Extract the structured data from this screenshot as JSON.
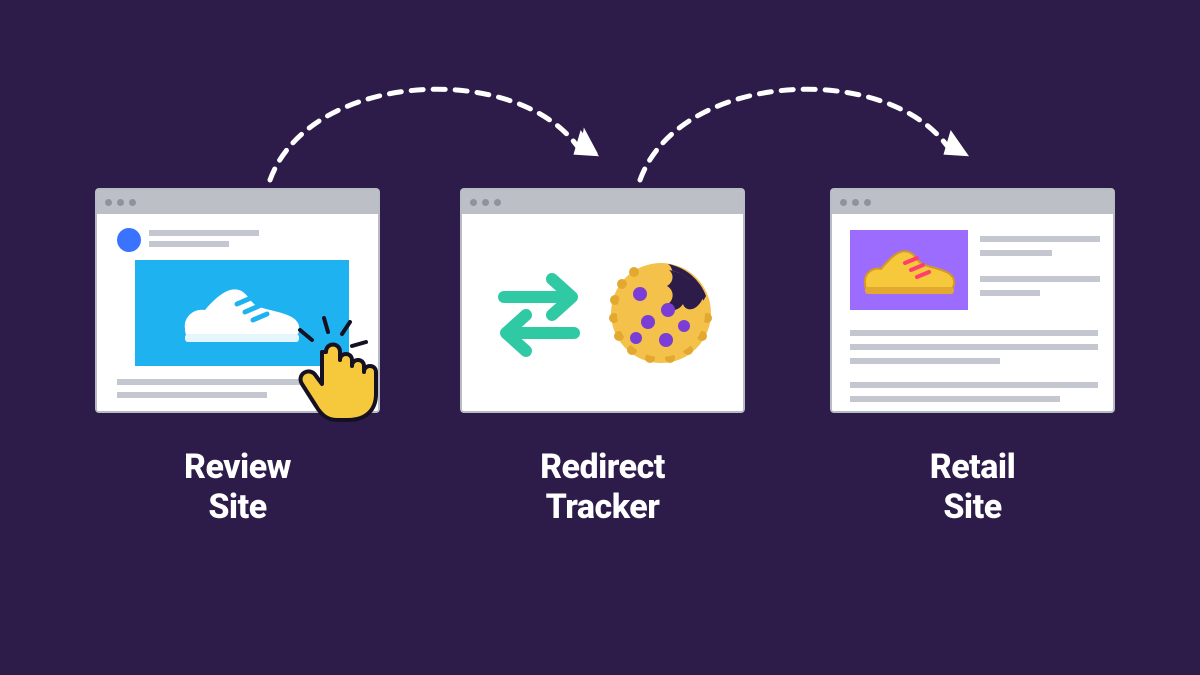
{
  "panels": {
    "review": {
      "label": "Review\nSite"
    },
    "redirect": {
      "label": "Redirect\nTracker"
    },
    "retail": {
      "label": "Retail\nSite"
    }
  },
  "icons": {
    "shoe_white": "shoe-icon",
    "shoe_yellow": "shoe-icon",
    "cursor": "pointer-click-icon",
    "swap": "swap-arrows-icon",
    "cookie": "cookie-icon"
  },
  "colors": {
    "bg": "#2d1b4a",
    "accent_blue": "#1fb2f0",
    "accent_purple": "#9c6cff",
    "teal": "#2fc9a3",
    "yellow": "#f6c93c",
    "cookie": "#f4c14b",
    "cookie_dark": "#e2a82f",
    "chip": "#7a3ed7"
  }
}
